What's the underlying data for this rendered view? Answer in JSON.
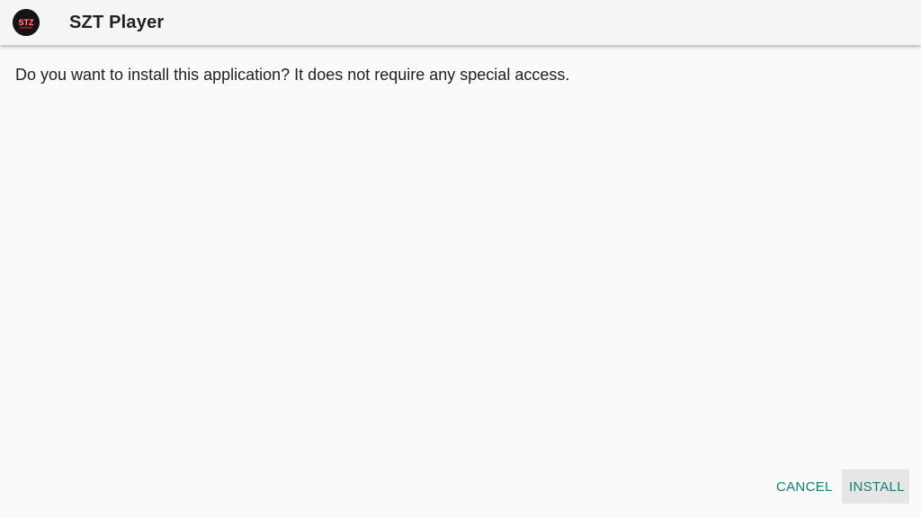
{
  "app_bar": {
    "icon": "szt-logo-icon",
    "icon_text": "STZ",
    "title": "SZT Player"
  },
  "content": {
    "message": "Do you want to install this application? It does not require any special access."
  },
  "actions": {
    "cancel_label": "CANCEL",
    "install_label": "INSTALL"
  },
  "colors": {
    "accent": "#0f7f74",
    "background": "#fafafa",
    "app_bar": "#f5f5f5",
    "icon_bg": "#141414",
    "icon_red": "#d0121b"
  }
}
